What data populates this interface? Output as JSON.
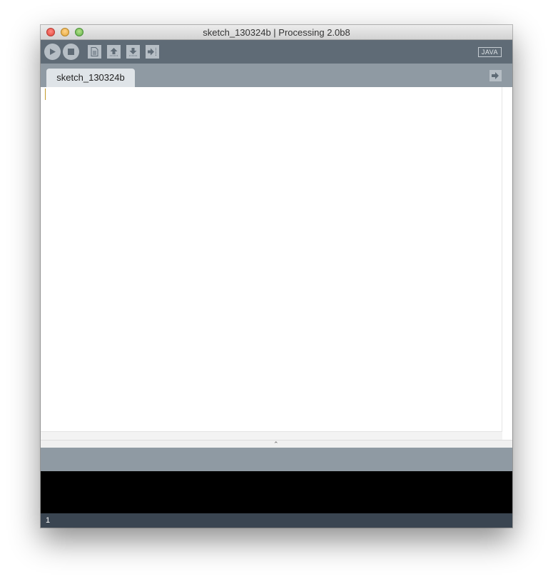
{
  "window": {
    "title": "sketch_130324b | Processing 2.0b8"
  },
  "toolbar": {
    "buttons": [
      {
        "name": "Run",
        "icon": "play-icon"
      },
      {
        "name": "Stop",
        "icon": "stop-icon"
      },
      {
        "name": "New",
        "icon": "new-file-icon"
      },
      {
        "name": "Open",
        "icon": "open-arrow-up-icon"
      },
      {
        "name": "Save",
        "icon": "save-arrow-down-icon"
      },
      {
        "name": "Export",
        "icon": "export-arrow-icon"
      }
    ],
    "mode": "JAVA"
  },
  "tabs": {
    "active": "sketch_130324b",
    "menu_icon": "tab-menu-arrow-icon"
  },
  "editor": {
    "content": ""
  },
  "console": {
    "message": "",
    "output": ""
  },
  "status": {
    "line_number": "1"
  },
  "colors": {
    "toolbar_bg": "#5f6b76",
    "tabbar_bg": "#8f9aa3",
    "tab_active_bg": "#dfe4e8",
    "console_bg": "#000000",
    "status_bg": "#3a4551"
  }
}
